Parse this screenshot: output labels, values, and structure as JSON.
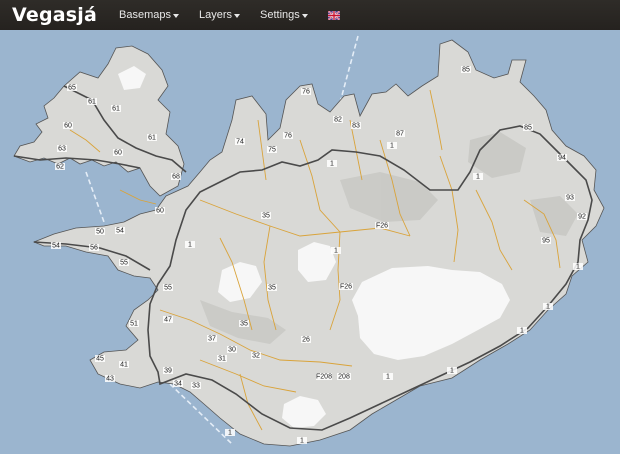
{
  "app": {
    "title": "Vegasjá"
  },
  "nav": {
    "items": [
      {
        "label": "Basemaps"
      },
      {
        "label": "Layers"
      },
      {
        "label": "Settings"
      }
    ],
    "language_icon": "union-jack-flag-icon"
  },
  "map": {
    "colors": {
      "sea": "#9bb5cf",
      "land": "#d9d9d6",
      "glacier": "#f7f7f7",
      "primary_road": "#4a4a4a",
      "secondary_road": "#d9a33a",
      "ferry_route": "#dfe9f5"
    },
    "road_labels": [
      "65",
      "61",
      "61",
      "61",
      "63",
      "62",
      "60",
      "68",
      "60",
      "60",
      "54",
      "56",
      "50",
      "54",
      "55",
      "1",
      "76",
      "82",
      "83",
      "85",
      "74",
      "75",
      "76",
      "1",
      "1",
      "87",
      "85",
      "94",
      "93",
      "92",
      "1",
      "95",
      "1",
      "1",
      "1",
      "35",
      "F26",
      "35",
      "F26",
      "35",
      "55",
      "47",
      "51",
      "37",
      "30",
      "32",
      "26",
      "45",
      "41",
      "43",
      "39",
      "34",
      "33",
      "31",
      "208",
      "F208",
      "1",
      "1",
      "1",
      "1",
      "1"
    ]
  }
}
